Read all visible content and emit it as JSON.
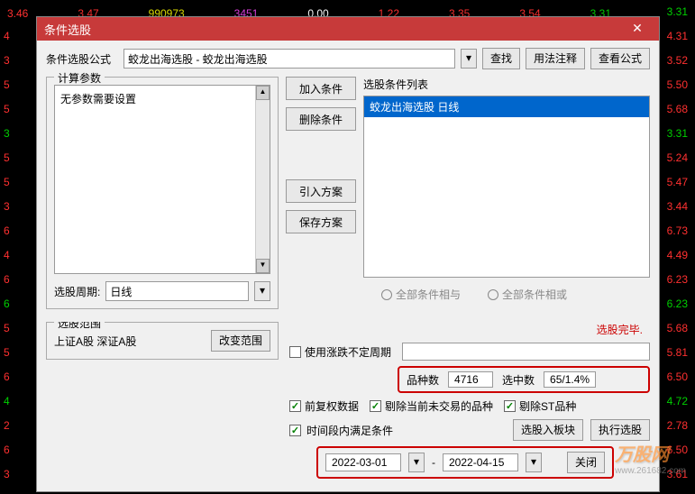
{
  "bg_top_row": [
    "3.46",
    "3.47",
    "990973",
    "3451",
    "0.00",
    "1.22",
    "3.35",
    "3.54",
    "3.31"
  ],
  "bg_right_col": [
    "3.31",
    "4.31",
    "3.52",
    "5.50",
    "5.68",
    "3.31",
    "5.24",
    "5.47",
    "3.44",
    "6.73",
    "4.49",
    "6.23",
    "6.23",
    "5.68",
    "5.81",
    "6.50",
    "4.72",
    "2.78",
    "6.50",
    "3.61"
  ],
  "bg_left_col": [
    "4",
    "3",
    "5",
    "5",
    "3",
    "5",
    "5",
    "3",
    "6",
    "4",
    "6",
    "6",
    "5",
    "5",
    "6",
    "4",
    "2",
    "6",
    "3"
  ],
  "dialog": {
    "title": "条件选股",
    "formula_label": "条件选股公式",
    "formula_value": "蛟龙出海选股 - 蛟龙出海选股",
    "search_btn": "查找",
    "usage_btn": "用法注释",
    "view_formula_btn": "查看公式",
    "params_title": "计算参数",
    "no_params_text": "无参数需要设置",
    "period_label": "选股周期:",
    "period_value": "日线",
    "add_condition_btn": "加入条件",
    "remove_condition_btn": "删除条件",
    "import_plan_btn": "引入方案",
    "save_plan_btn": "保存方案",
    "list_label": "选股条件列表",
    "list_item": "蛟龙出海选股  日线",
    "radio_and": "全部条件相与",
    "radio_or": "全部条件相或",
    "range_title": "选股范围",
    "range_text": "上证A股 深证A股",
    "change_range_btn": "改变范围",
    "status_text": "选股完毕.",
    "uncertain_period_label": "使用涨跌不定周期",
    "stats_variety_label": "品种数",
    "stats_variety_value": "4716",
    "stats_selected_label": "选中数",
    "stats_selected_value": "65/1.4%",
    "check_adj": "前复权数据",
    "check_remove_untrade": "剔除当前未交易的品种",
    "check_remove_st": "剔除ST品种",
    "check_time_satisfy": "时间段内满足条件",
    "select_to_block_btn": "选股入板块",
    "execute_btn": "执行选股",
    "date_start": "2022-03-01",
    "date_end": "2022-04-15",
    "close_btn": "关闭"
  },
  "watermark": {
    "text": "万股网",
    "url": "www.261682.com"
  }
}
